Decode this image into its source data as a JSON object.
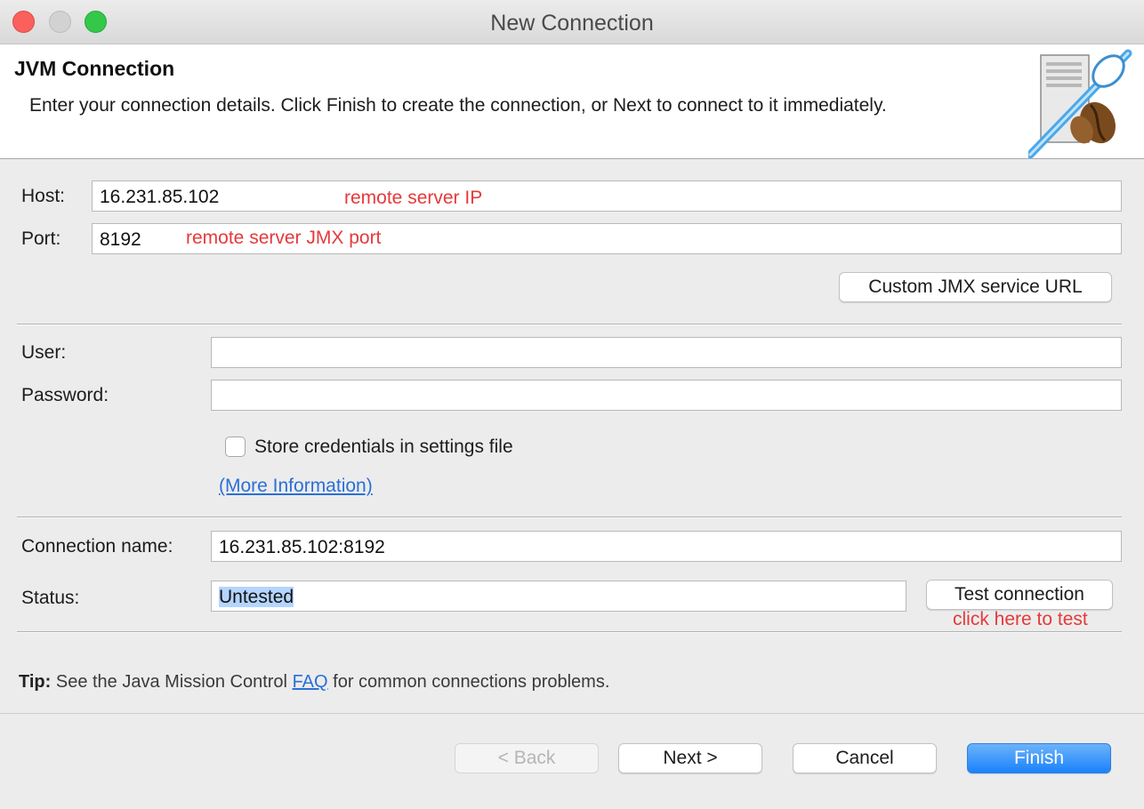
{
  "window": {
    "title": "New Connection",
    "traffic_lights": [
      "close",
      "minimize",
      "maximize"
    ]
  },
  "header": {
    "title": "JVM Connection",
    "description": "Enter your connection details. Click Finish to create the connection, or Next to connect to it immediately.",
    "icon": "server-connection-icon"
  },
  "host": {
    "label": "Host:",
    "value": "16.231.85.102",
    "annotation": "remote server IP"
  },
  "port": {
    "label": "Port:",
    "value": "8192",
    "annotation": "remote server JMX port"
  },
  "custom_jmx_button": "Custom JMX service URL",
  "user": {
    "label": "User:",
    "value": ""
  },
  "password": {
    "label": "Password:",
    "value": ""
  },
  "store_credentials": {
    "label": "Store credentials in settings file",
    "checked": false
  },
  "more_info_link": "(More Information)",
  "connection_name": {
    "label": "Connection name:",
    "value": "16.231.85.102:8192"
  },
  "status": {
    "label": "Status:",
    "value": "Untested"
  },
  "test_connection_button": "Test connection",
  "test_annotation": "click here to test",
  "tip": {
    "bold": "Tip:",
    "before": "See the Java Mission Control",
    "link": "FAQ",
    "after": "for common connections problems."
  },
  "footer": {
    "back": "< Back",
    "next": "Next >",
    "cancel": "Cancel",
    "finish": "Finish"
  },
  "colors": {
    "annotation": "#e6393a",
    "primary_button": "#1a82fb",
    "link": "#2b6fd6",
    "selection": "#b4d5fe"
  }
}
